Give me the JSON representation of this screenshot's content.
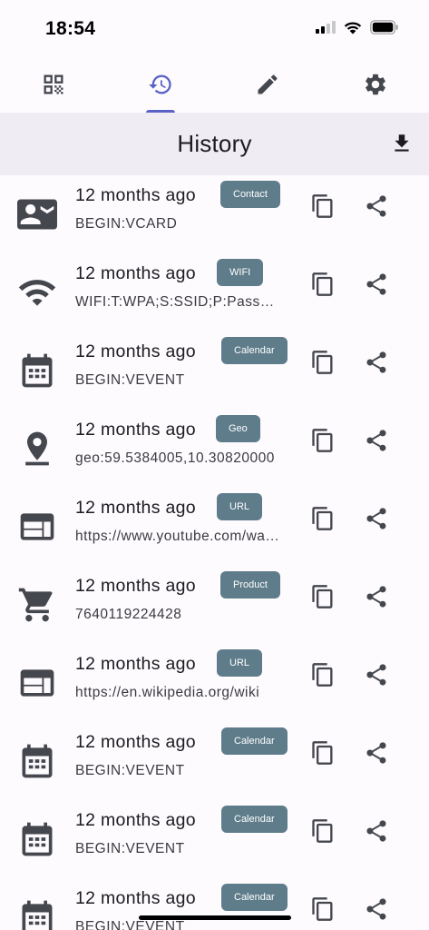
{
  "status_bar": {
    "time": "18:54"
  },
  "tabs": [
    {
      "name": "scan",
      "icon": "qr-code-icon"
    },
    {
      "name": "history",
      "icon": "history-icon",
      "active": true
    },
    {
      "name": "create",
      "icon": "pencil-icon"
    },
    {
      "name": "settings",
      "icon": "gear-icon"
    }
  ],
  "header": {
    "title": "History"
  },
  "colors": {
    "accent": "#5a63c5",
    "badge": "#5e7c8a",
    "header_bg": "#efecf4",
    "icon": "#44474e"
  },
  "history": [
    {
      "icon": "contact-card-icon",
      "time": "12 months ago",
      "type": "Contact",
      "content": "BEGIN:VCARD"
    },
    {
      "icon": "wifi-icon",
      "time": "12 months ago",
      "type": "WIFI",
      "content": "WIFI:T:WPA;S:SSID;P:Password;H:true;;"
    },
    {
      "icon": "calendar-icon",
      "time": "12 months ago",
      "type": "Calendar",
      "content": "BEGIN:VEVENT"
    },
    {
      "icon": "location-pin-icon",
      "time": "12 months ago",
      "type": "Geo",
      "content": "geo:59.5384005,10.30820000"
    },
    {
      "icon": "web-icon",
      "time": "12 months ago",
      "type": "URL",
      "content": "https://www.youtube.com/watch"
    },
    {
      "icon": "shopping-cart-icon",
      "time": "12 months ago",
      "type": "Product",
      "content": "7640119224428"
    },
    {
      "icon": "web-icon",
      "time": "12 months ago",
      "type": "URL",
      "content": "https://en.wikipedia.org/wiki"
    },
    {
      "icon": "calendar-icon",
      "time": "12 months ago",
      "type": "Calendar",
      "content": "BEGIN:VEVENT"
    },
    {
      "icon": "calendar-icon",
      "time": "12 months ago",
      "type": "Calendar",
      "content": "BEGIN:VEVENT"
    },
    {
      "icon": "calendar-icon",
      "time": "12 months ago",
      "type": "Calendar",
      "content": "BEGIN:VEVENT"
    }
  ]
}
